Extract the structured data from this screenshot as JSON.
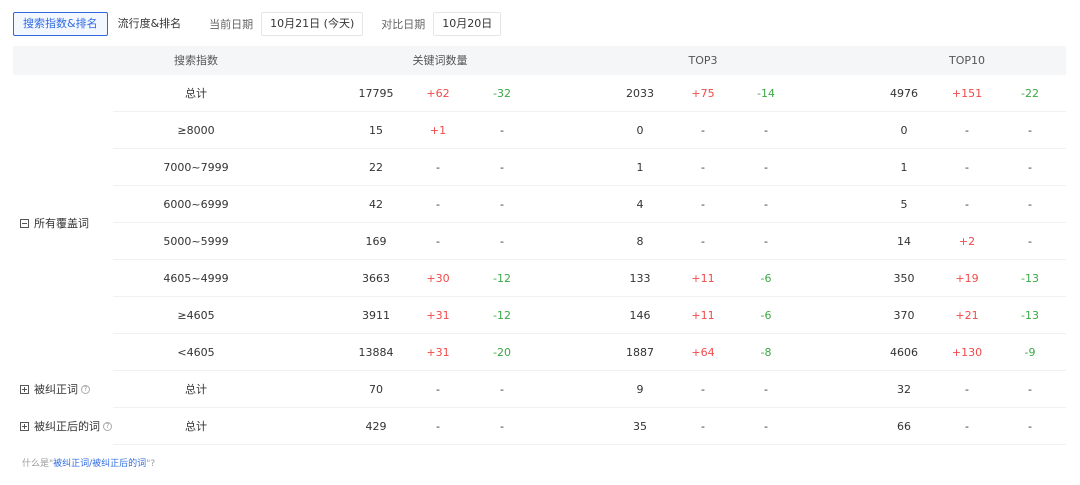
{
  "toolbar": {
    "tabs": [
      {
        "label": "搜索指数&排名",
        "active": true
      },
      {
        "label": "流行度&排名",
        "active": false
      }
    ],
    "current_date_label": "当前日期",
    "current_date_value": "10月21日 (今天)",
    "compare_date_label": "对比日期",
    "compare_date_value": "10月20日"
  },
  "table": {
    "headers": {
      "search_index": "搜索指数",
      "keyword_count": "关键词数量",
      "top3": "TOP3",
      "top10": "TOP10"
    },
    "groups": {
      "all": "所有覆盖词",
      "corrected": "被纠正词",
      "after_corrected": "被纠正后的词"
    },
    "rows": [
      {
        "range": "总计",
        "kw": "17795",
        "kw_up": "+62",
        "kw_down": "-32",
        "t3": "2033",
        "t3_up": "+75",
        "t3_down": "-14",
        "t10": "4976",
        "t10_up": "+151",
        "t10_down": "-22"
      },
      {
        "range": "≥8000",
        "kw": "15",
        "kw_up": "+1",
        "kw_down": "-",
        "t3": "0",
        "t3_up": "-",
        "t3_down": "-",
        "t10": "0",
        "t10_up": "-",
        "t10_down": "-"
      },
      {
        "range": "7000~7999",
        "kw": "22",
        "kw_up": "-",
        "kw_down": "-",
        "t3": "1",
        "t3_up": "-",
        "t3_down": "-",
        "t10": "1",
        "t10_up": "-",
        "t10_down": "-"
      },
      {
        "range": "6000~6999",
        "kw": "42",
        "kw_up": "-",
        "kw_down": "-",
        "t3": "4",
        "t3_up": "-",
        "t3_down": "-",
        "t10": "5",
        "t10_up": "-",
        "t10_down": "-"
      },
      {
        "range": "5000~5999",
        "kw": "169",
        "kw_up": "-",
        "kw_down": "-",
        "t3": "8",
        "t3_up": "-",
        "t3_down": "-",
        "t10": "14",
        "t10_up": "+2",
        "t10_down": "-"
      },
      {
        "range": "4605~4999",
        "kw": "3663",
        "kw_up": "+30",
        "kw_down": "-12",
        "t3": "133",
        "t3_up": "+11",
        "t3_down": "-6",
        "t10": "350",
        "t10_up": "+19",
        "t10_down": "-13"
      },
      {
        "range": "≥4605",
        "kw": "3911",
        "kw_up": "+31",
        "kw_down": "-12",
        "t3": "146",
        "t3_up": "+11",
        "t3_down": "-6",
        "t10": "370",
        "t10_up": "+21",
        "t10_down": "-13"
      },
      {
        "range": "<4605",
        "kw": "13884",
        "kw_up": "+31",
        "kw_down": "-20",
        "t3": "1887",
        "t3_up": "+64",
        "t3_down": "-8",
        "t10": "4606",
        "t10_up": "+130",
        "t10_down": "-9"
      },
      {
        "range": "总计",
        "kw": "70",
        "kw_up": "-",
        "kw_down": "-",
        "t3": "9",
        "t3_up": "-",
        "t3_down": "-",
        "t10": "32",
        "t10_up": "-",
        "t10_down": "-"
      },
      {
        "range": "总计",
        "kw": "429",
        "kw_up": "-",
        "kw_down": "-",
        "t3": "35",
        "t3_up": "-",
        "t3_down": "-",
        "t10": "66",
        "t10_up": "-",
        "t10_down": "-"
      }
    ]
  },
  "footnote": {
    "prefix": "什么是\"",
    "link": "被纠正词/被纠正后的词",
    "suffix": "\"?"
  },
  "colors": {
    "accent": "#2f6be0",
    "up": "#f04a4a",
    "down": "#3aa845"
  }
}
